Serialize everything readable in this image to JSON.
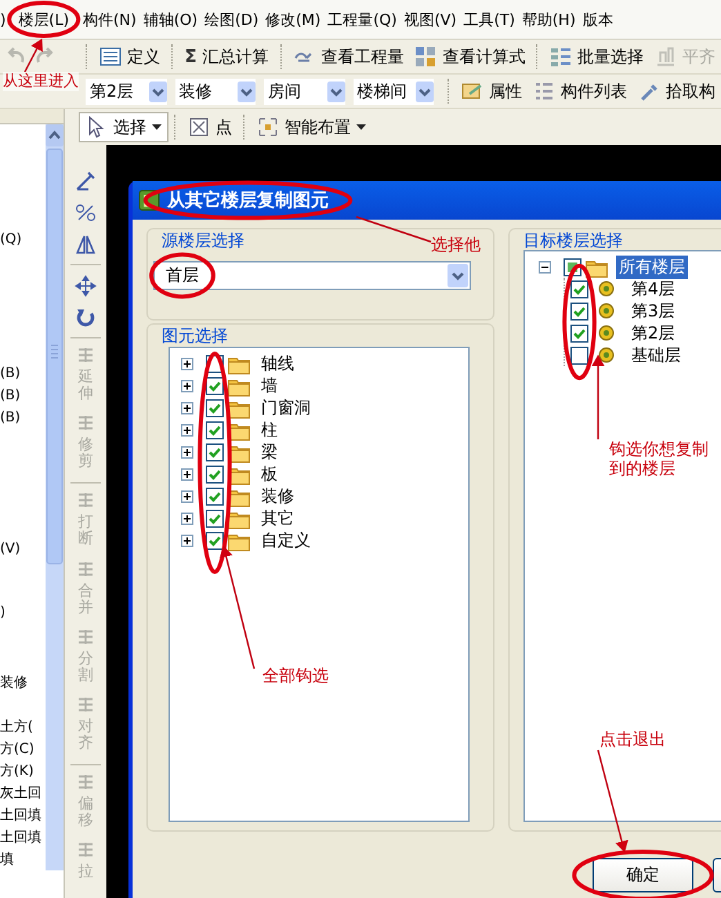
{
  "menu_bar": {
    "items": [
      {
        "label": ")"
      },
      {
        "label": "楼层(L)"
      },
      {
        "label": "构件(N)"
      },
      {
        "label": "辅轴(O)"
      },
      {
        "label": "绘图(D)"
      },
      {
        "label": "修改(M)"
      },
      {
        "label": "工程量(Q)"
      },
      {
        "label": "视图(V)"
      },
      {
        "label": "工具(T)"
      },
      {
        "label": "帮助(H)"
      },
      {
        "label": "版本"
      }
    ]
  },
  "main_toolbar": {
    "buttons": [
      {
        "label": "定义",
        "disabled": false
      },
      {
        "glyph": "Σ",
        "label": "汇总计算",
        "disabled": false
      },
      {
        "label": "查看工程量",
        "disabled": false
      },
      {
        "label": "查看计算式",
        "disabled": false
      },
      {
        "label": "批量选择",
        "disabled": false
      },
      {
        "label": "平齐",
        "disabled": true
      }
    ]
  },
  "floor_toolbar": {
    "dropdowns": [
      {
        "value": "第2层"
      },
      {
        "value": "装修"
      },
      {
        "value": "房间"
      },
      {
        "value": "楼梯间"
      }
    ],
    "buttons": [
      {
        "label": "属性"
      },
      {
        "label": "构件列表"
      },
      {
        "label": "拾取构"
      }
    ]
  },
  "draw_toolbar": {
    "buttons": [
      {
        "label": "选择",
        "selected": true,
        "dropdown": true
      },
      {
        "label": "点",
        "selected": false,
        "dropdown": false
      },
      {
        "label": "智能布置",
        "selected": false,
        "dropdown": true
      }
    ]
  },
  "side_list": {
    "items": [
      {
        "text": "(Q)"
      },
      {
        "text": "(B)"
      },
      {
        "text": "(B)"
      },
      {
        "text": "(B)"
      },
      {
        "text": "(V)"
      },
      {
        "text": ")"
      },
      {
        "text": "装修"
      },
      {
        "text": "土方("
      },
      {
        "text": "方(C)"
      },
      {
        "text": "方(K)"
      },
      {
        "text": "灰土回"
      },
      {
        "text": "土回填"
      },
      {
        "text": "土回填"
      },
      {
        "text": "填"
      }
    ]
  },
  "edit_tools": {
    "items": [
      {
        "label": "延伸"
      },
      {
        "label": "修剪"
      },
      {
        "label": "打断"
      },
      {
        "label": "合并"
      },
      {
        "label": "分割"
      },
      {
        "label": "对齐"
      },
      {
        "label": "偏移"
      },
      {
        "label": "拉"
      }
    ]
  },
  "dialog": {
    "title": "从其它楼层复制图元",
    "source_group": {
      "label": "源楼层选择",
      "combo": {
        "value": "首层"
      }
    },
    "element_group": {
      "label": "图元选择",
      "items": [
        {
          "label": "轴线",
          "checked": false,
          "expanded": false
        },
        {
          "label": "墙",
          "checked": true,
          "expanded": false
        },
        {
          "label": "门窗洞",
          "checked": true,
          "expanded": false
        },
        {
          "label": "柱",
          "checked": true,
          "expanded": false
        },
        {
          "label": "梁",
          "checked": true,
          "expanded": false
        },
        {
          "label": "板",
          "checked": true,
          "expanded": false
        },
        {
          "label": "装修",
          "checked": true,
          "expanded": false
        },
        {
          "label": "其它",
          "checked": true,
          "expanded": false
        },
        {
          "label": "自定义",
          "checked": true,
          "expanded": false
        }
      ]
    },
    "target_group": {
      "label": "目标楼层选择",
      "root": {
        "label": "所有楼层",
        "checked": false,
        "partial": true,
        "selected": true,
        "expanded": true,
        "children": [
          {
            "label": "第4层",
            "checked": true
          },
          {
            "label": "第3层",
            "checked": true
          },
          {
            "label": "第2层",
            "checked": true
          },
          {
            "label": "基础层",
            "checked": false
          }
        ]
      }
    },
    "buttons": [
      {
        "label": "确定"
      }
    ]
  },
  "annotations": [
    {
      "text": "从这里进入"
    },
    {
      "text": "选择他"
    },
    {
      "text": "钩选你想复制到的楼层"
    },
    {
      "text": "全部钩选"
    },
    {
      "text": "点击退出"
    }
  ]
}
